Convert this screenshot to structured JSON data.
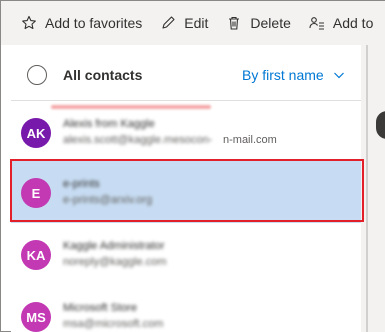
{
  "toolbar": {
    "add_favorites_label": "Add to favorites",
    "edit_label": "Edit",
    "delete_label": "Delete",
    "add_to_label": "Add to"
  },
  "list": {
    "all_contacts_label": "All contacts",
    "sort_label": "By first name",
    "contacts": [
      {
        "initials": "AK",
        "name": "Alexis from Kaggle",
        "email_blurred": "alexis.scott@kaggle.mesocon-",
        "email_visible": "n-mail.com",
        "avatar_color": "#7719aa"
      },
      {
        "initials": "E",
        "name": "e-prints",
        "email": "e-prints@arxiv.org",
        "avatar_color": "#c239b3"
      },
      {
        "initials": "KA",
        "name": "Kaggle Administrator",
        "email": "noreply@kaggle.com",
        "avatar_color": "#c239b3"
      },
      {
        "initials": "MS",
        "name": "Microsoft Store",
        "email": "msa@microsoft.com",
        "avatar_color": "#c239b3"
      }
    ]
  },
  "colors": {
    "accent": "#0078d4",
    "selected_row": "#c7dcf2",
    "highlight_border": "#e3202a"
  }
}
